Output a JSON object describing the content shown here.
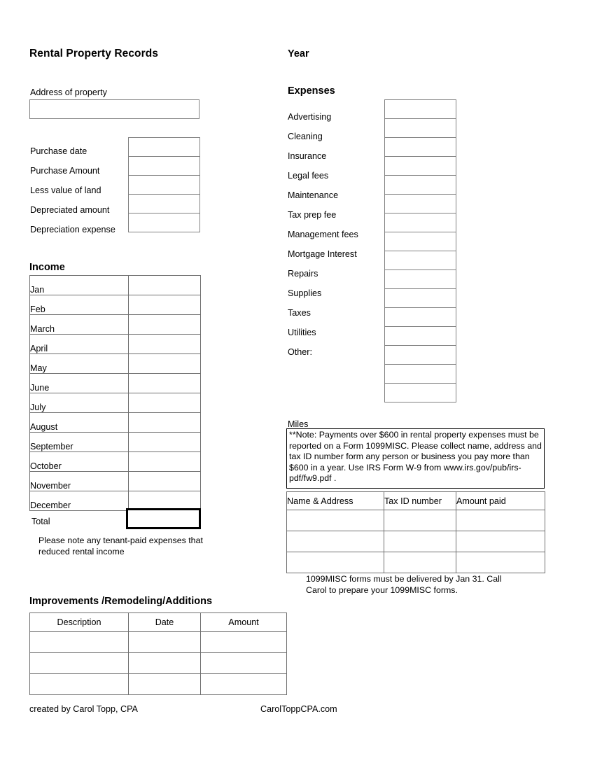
{
  "document": {
    "title": "Rental Property Records",
    "year_label": "Year"
  },
  "property": {
    "address_label": "Address of property",
    "address_value": "",
    "details": [
      {
        "label": "Purchase date",
        "value": ""
      },
      {
        "label": "Purchase Amount",
        "value": ""
      },
      {
        "label": "Less value of land",
        "value": ""
      },
      {
        "label": "Depreciated amount",
        "value": ""
      },
      {
        "label": "Depreciation expense",
        "value": ""
      }
    ]
  },
  "income": {
    "heading": "Income",
    "months": [
      {
        "label": "Jan",
        "value": ""
      },
      {
        "label": "Feb",
        "value": ""
      },
      {
        "label": "March",
        "value": ""
      },
      {
        "label": "April",
        "value": ""
      },
      {
        "label": "May",
        "value": ""
      },
      {
        "label": "June",
        "value": ""
      },
      {
        "label": "July",
        "value": ""
      },
      {
        "label": "August",
        "value": ""
      },
      {
        "label": "September",
        "value": ""
      },
      {
        "label": "October",
        "value": ""
      },
      {
        "label": "November",
        "value": ""
      },
      {
        "label": "December",
        "value": ""
      }
    ],
    "total_label": "Total",
    "total_value": "",
    "note": "Please note any tenant-paid expenses that reduced rental income"
  },
  "expenses": {
    "heading": "Expenses",
    "items": [
      {
        "label": "Advertising",
        "value": ""
      },
      {
        "label": "Cleaning",
        "value": ""
      },
      {
        "label": "Insurance",
        "value": ""
      },
      {
        "label": "Legal fees",
        "value": ""
      },
      {
        "label": "Maintenance",
        "value": ""
      },
      {
        "label": "Tax prep fee",
        "value": ""
      },
      {
        "label": "Management fees",
        "value": ""
      },
      {
        "label": "Mortgage Interest",
        "value": ""
      },
      {
        "label": "Repairs",
        "value": ""
      },
      {
        "label": "Supplies",
        "value": ""
      },
      {
        "label": "Taxes",
        "value": ""
      },
      {
        "label": "Utilities",
        "value": ""
      },
      {
        "label": "Other:",
        "value": ""
      }
    ],
    "extra_blank_rows": 3,
    "miles_label": "Miles",
    "miles_value": ""
  },
  "notice": {
    "text": "**Note: Payments over $600 in rental property expenses must be reported on a Form 1099MISC. Please collect name, address and tax ID number form any person or business you pay more than $600 in a year. Use IRS Form W-9 from www.irs.gov/pub/irs-pdf/fw9.pdf ."
  },
  "vendor_table": {
    "columns": [
      "Name & Address",
      "Tax ID number",
      "Amount paid"
    ],
    "rows": [
      {
        "name_address": "",
        "tax_id": "",
        "amount_paid": ""
      },
      {
        "name_address": "",
        "tax_id": "",
        "amount_paid": ""
      },
      {
        "name_address": "",
        "tax_id": "",
        "amount_paid": ""
      }
    ],
    "footnote": "1099MISC forms must be delivered by Jan 31. Call Carol to prepare your 1099MISC forms."
  },
  "improvements": {
    "heading": "Improvements /Remodeling/Additions",
    "columns": [
      "Description",
      "Date",
      "Amount"
    ],
    "rows": [
      {
        "description": "",
        "date": "",
        "amount": ""
      },
      {
        "description": "",
        "date": "",
        "amount": ""
      },
      {
        "description": "",
        "date": "",
        "amount": ""
      }
    ]
  },
  "footer": {
    "created_by": "created by Carol Topp, CPA",
    "website": "CarolToppCPA.com"
  }
}
